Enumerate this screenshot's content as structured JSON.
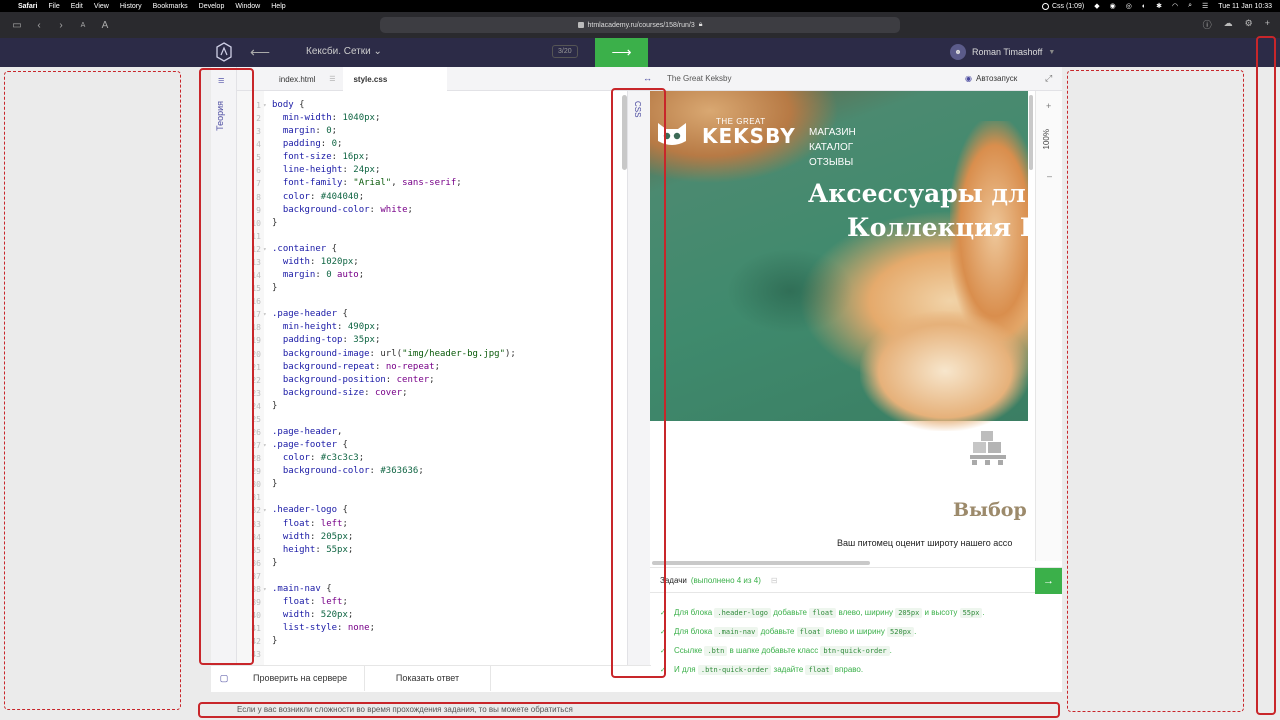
{
  "menubar": {
    "app": "Safari",
    "items": [
      "File",
      "Edit",
      "View",
      "History",
      "Bookmarks",
      "Develop",
      "Window",
      "Help"
    ],
    "status": "Css (1:09)",
    "datetime": "Tue 11 Jan  10:33"
  },
  "safari": {
    "url": "htmlacademy.ru/courses/158/run/3",
    "text_size_small": "A",
    "text_size_large": "A"
  },
  "header": {
    "course_title": "Кексби. Сетки",
    "page_counter": "3/20",
    "user_name": "Roman Timashoff",
    "next_arrow": "⟶",
    "back_arrow": "⟵"
  },
  "theory": {
    "label": "Теория"
  },
  "tabs": [
    {
      "label": "index.html"
    },
    {
      "label": "style.css"
    }
  ],
  "css_rail": {
    "label": "CSS"
  },
  "code_lines": [
    {
      "n": "1",
      "fold": true,
      "html": "<span class='sel'>body</span> {"
    },
    {
      "n": "2",
      "html": "  <span class='prop'>min-width</span>: <span class='num'>1040px</span>;"
    },
    {
      "n": "3",
      "html": "  <span class='prop'>margin</span>: <span class='num'>0</span>;"
    },
    {
      "n": "4",
      "html": "  <span class='prop'>padding</span>: <span class='num'>0</span>;"
    },
    {
      "n": "5",
      "html": "  <span class='prop'>font-size</span>: <span class='num'>16px</span>;"
    },
    {
      "n": "6",
      "html": "  <span class='prop'>line-height</span>: <span class='num'>24px</span>;"
    },
    {
      "n": "7",
      "html": "  <span class='prop'>font-family</span>: <span class='str'>\"Arial\"</span>, <span class='val'>sans-serif</span>;"
    },
    {
      "n": "8",
      "html": "  <span class='prop'>color</span>: <span class='num'>#404040</span>;"
    },
    {
      "n": "9",
      "html": "  <span class='prop'>background-color</span>: <span class='val'>white</span>;"
    },
    {
      "n": "10",
      "html": "}"
    },
    {
      "n": "11",
      "html": ""
    },
    {
      "n": "12",
      "fold": true,
      "html": "<span class='sel'>.container</span> {"
    },
    {
      "n": "13",
      "html": "  <span class='prop'>width</span>: <span class='num'>1020px</span>;"
    },
    {
      "n": "14",
      "html": "  <span class='prop'>margin</span>: <span class='num'>0</span> <span class='val'>auto</span>;"
    },
    {
      "n": "15",
      "html": "}"
    },
    {
      "n": "16",
      "html": ""
    },
    {
      "n": "17",
      "fold": true,
      "html": "<span class='sel'>.page-header</span> {"
    },
    {
      "n": "18",
      "html": "  <span class='prop'>min-height</span>: <span class='num'>490px</span>;"
    },
    {
      "n": "19",
      "html": "  <span class='prop'>padding-top</span>: <span class='num'>35px</span>;"
    },
    {
      "n": "20",
      "html": "  <span class='prop'>background-image</span>: url(<span class='str'>\"img/header-bg.jpg\"</span>);"
    },
    {
      "n": "21",
      "html": "  <span class='prop'>background-repeat</span>: <span class='val'>no-repeat</span>;"
    },
    {
      "n": "22",
      "html": "  <span class='prop'>background-position</span>: <span class='val'>center</span>;"
    },
    {
      "n": "23",
      "html": "  <span class='prop'>background-size</span>: <span class='val'>cover</span>;"
    },
    {
      "n": "24",
      "html": "}"
    },
    {
      "n": "25",
      "html": ""
    },
    {
      "n": "26",
      "html": "<span class='sel'>.page-header</span>,"
    },
    {
      "n": "27",
      "fold": true,
      "html": "<span class='sel'>.page-footer</span> {"
    },
    {
      "n": "28",
      "html": "  <span class='prop'>color</span>: <span class='num'>#c3c3c3</span>;"
    },
    {
      "n": "29",
      "html": "  <span class='prop'>background-color</span>: <span class='num'>#363636</span>;"
    },
    {
      "n": "30",
      "html": "}"
    },
    {
      "n": "31",
      "html": ""
    },
    {
      "n": "32",
      "fold": true,
      "html": "<span class='sel'>.header-logo</span> {"
    },
    {
      "n": "33",
      "html": "  <span class='prop'>float</span>: <span class='val'>left</span>;"
    },
    {
      "n": "34",
      "html": "  <span class='prop'>width</span>: <span class='num'>205px</span>;"
    },
    {
      "n": "35",
      "html": "  <span class='prop'>height</span>: <span class='num'>55px</span>;"
    },
    {
      "n": "36",
      "html": "}"
    },
    {
      "n": "37",
      "html": ""
    },
    {
      "n": "38",
      "fold": true,
      "html": "<span class='sel'>.main-nav</span> {"
    },
    {
      "n": "39",
      "html": "  <span class='prop'>float</span>: <span class='val'>left</span>;"
    },
    {
      "n": "40",
      "html": "  <span class='prop'>width</span>: <span class='num'>520px</span>;"
    },
    {
      "n": "41",
      "html": "  <span class='prop'>list-style</span>: <span class='val'>none</span>;"
    },
    {
      "n": "42",
      "html": "}"
    },
    {
      "n": "43",
      "html": ""
    }
  ],
  "editor_footer": {
    "check_label": "Проверить на сервере",
    "answer_label": "Показать ответ"
  },
  "preview": {
    "title": "The Great Keksby",
    "autorun_label": "Автозапуск",
    "zoom": "100%",
    "site": {
      "the_great": "THE GREAT",
      "keksby": "KEKSBY",
      "nav": [
        "МАГАЗИН",
        "КАТАЛОГ",
        "ОТЗЫВЫ"
      ],
      "headline_1": "Аксессуары дл",
      "headline_2": "Коллекция К",
      "section_title": "Выбор",
      "section_text": "Ваш питомец оценит широту нашего ассо"
    }
  },
  "tasks": {
    "title": "Задачи",
    "count": "(выполнено 4 из 4)",
    "items": [
      [
        {
          "t": "Для блока "
        },
        {
          "c": ".header-logo"
        },
        {
          "t": " добавьте "
        },
        {
          "c": "float"
        },
        {
          "t": " влево, ширину "
        },
        {
          "c": "205px"
        },
        {
          "t": " и высоту "
        },
        {
          "c": "55px"
        },
        {
          "t": "."
        }
      ],
      [
        {
          "t": "Для блока "
        },
        {
          "c": ".main-nav"
        },
        {
          "t": " добавьте "
        },
        {
          "c": "float"
        },
        {
          "t": " влево и ширину "
        },
        {
          "c": "520px"
        },
        {
          "t": "."
        }
      ],
      [
        {
          "t": "Ссылке "
        },
        {
          "c": ".btn"
        },
        {
          "t": " в шапке добавьте класс "
        },
        {
          "c": "btn-quick-order"
        },
        {
          "t": "."
        }
      ],
      [
        {
          "t": "И для "
        },
        {
          "c": ".btn-quick-order"
        },
        {
          "t": " задайте "
        },
        {
          "c": "float"
        },
        {
          "t": " вправо."
        }
      ]
    ]
  },
  "bottom_note": "Если у вас возникли сложности во время прохождения задания, то вы можете обратиться",
  "colors": {
    "accent_green": "#3bb04a",
    "header_bg": "#2c2b47",
    "annotation_red": "#c8262a"
  }
}
